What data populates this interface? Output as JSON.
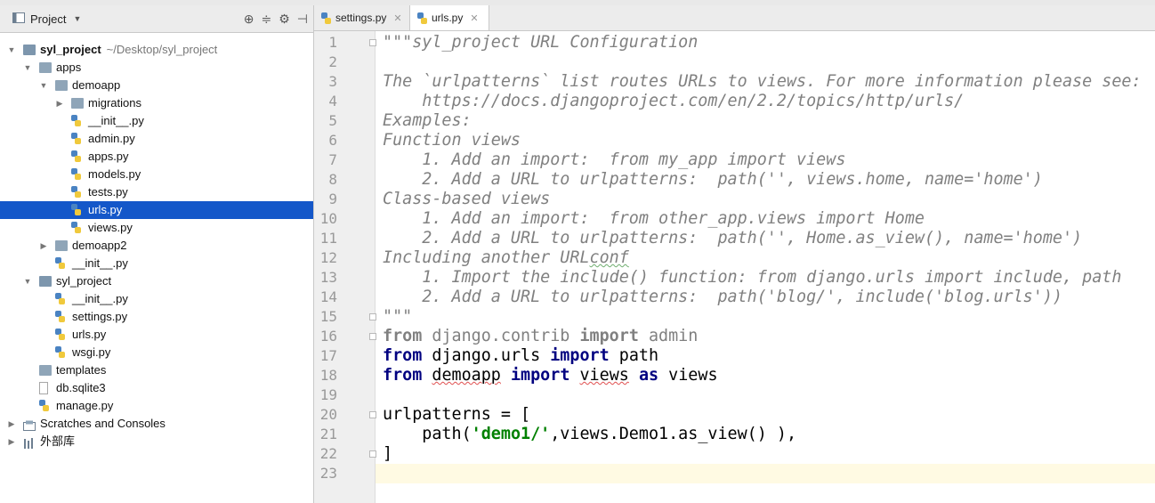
{
  "project_panel": {
    "title": "Project",
    "tree": [
      {
        "label": "syl_project",
        "sub": "~/Desktop/syl_project"
      },
      {
        "label": "apps"
      },
      {
        "label": "demoapp"
      },
      {
        "label": "migrations"
      },
      {
        "label": "__init__.py"
      },
      {
        "label": "admin.py"
      },
      {
        "label": "apps.py"
      },
      {
        "label": "models.py"
      },
      {
        "label": "tests.py"
      },
      {
        "label": "urls.py"
      },
      {
        "label": "views.py"
      },
      {
        "label": "demoapp2"
      },
      {
        "label": "__init__.py"
      },
      {
        "label": "syl_project"
      },
      {
        "label": "__init__.py"
      },
      {
        "label": "settings.py"
      },
      {
        "label": "urls.py"
      },
      {
        "label": "wsgi.py"
      },
      {
        "label": "templates"
      },
      {
        "label": "db.sqlite3"
      },
      {
        "label": "manage.py"
      },
      {
        "label": "Scratches and Consoles"
      },
      {
        "label": "外部库"
      }
    ]
  },
  "tabs": [
    {
      "label": "settings.py",
      "active": false
    },
    {
      "label": "urls.py",
      "active": true
    }
  ],
  "editor": {
    "line_numbers": [
      "1",
      "2",
      "3",
      "4",
      "5",
      "6",
      "7",
      "8",
      "9",
      "10",
      "11",
      "12",
      "13",
      "14",
      "15",
      "16",
      "17",
      "18",
      "19",
      "20",
      "21",
      "22",
      "23"
    ],
    "current_line": 23,
    "lines": [
      {
        "segs": [
          {
            "t": "\"\"\"syl_project URL Configuration",
            "c": "cm"
          }
        ]
      },
      {
        "segs": []
      },
      {
        "segs": [
          {
            "t": "The `urlpatterns` list routes URLs to views. For more information please see:",
            "c": "cm"
          }
        ]
      },
      {
        "segs": [
          {
            "t": "    https://docs.djangoproject.com/en/2.2/topics/http/urls/",
            "c": "cm"
          }
        ]
      },
      {
        "segs": [
          {
            "t": "Examples:",
            "c": "cm"
          }
        ]
      },
      {
        "segs": [
          {
            "t": "Function views",
            "c": "cm"
          }
        ]
      },
      {
        "segs": [
          {
            "t": "    1. Add an import:  from my_app import views",
            "c": "cm"
          }
        ]
      },
      {
        "segs": [
          {
            "t": "    2. Add a URL to urlpatterns:  path('', views.home, name='home')",
            "c": "cm"
          }
        ]
      },
      {
        "segs": [
          {
            "t": "Class-based views",
            "c": "cm"
          }
        ]
      },
      {
        "segs": [
          {
            "t": "    1. Add an import:  from other_app.views import Home",
            "c": "cm"
          }
        ]
      },
      {
        "segs": [
          {
            "t": "    2. Add a URL to urlpatterns:  path('', Home.as_view(), name='home')",
            "c": "cm"
          }
        ]
      },
      {
        "segs": [
          {
            "t": "Including another URL",
            "c": "cm"
          },
          {
            "t": "conf",
            "c": "cm sqg"
          }
        ]
      },
      {
        "segs": [
          {
            "t": "    1. Import the include() function: from django.urls import include, path",
            "c": "cm"
          }
        ]
      },
      {
        "segs": [
          {
            "t": "    2. Add a URL to urlpatterns:  path('blog/', include('blog.urls'))",
            "c": "cm"
          }
        ]
      },
      {
        "segs": [
          {
            "t": "\"\"\"",
            "c": "cm"
          }
        ]
      },
      {
        "segs": [
          {
            "t": "from",
            "c": "kwg"
          },
          {
            "t": " django.contrib ",
            "c": "gr"
          },
          {
            "t": "import",
            "c": "kwg"
          },
          {
            "t": " admin",
            "c": "gr"
          }
        ]
      },
      {
        "segs": [
          {
            "t": "from",
            "c": "kw"
          },
          {
            "t": " django.urls ",
            "c": ""
          },
          {
            "t": "import",
            "c": "kw"
          },
          {
            "t": " path",
            "c": ""
          }
        ]
      },
      {
        "segs": [
          {
            "t": "from",
            "c": "kw"
          },
          {
            "t": " ",
            "c": ""
          },
          {
            "t": "demoapp",
            "c": "sq"
          },
          {
            "t": " ",
            "c": ""
          },
          {
            "t": "import",
            "c": "kw"
          },
          {
            "t": " ",
            "c": ""
          },
          {
            "t": "views",
            "c": "sq"
          },
          {
            "t": " ",
            "c": ""
          },
          {
            "t": "as",
            "c": "kw"
          },
          {
            "t": " views",
            "c": ""
          }
        ]
      },
      {
        "segs": []
      },
      {
        "segs": [
          {
            "t": "urlpatterns = [",
            "c": ""
          }
        ]
      },
      {
        "segs": [
          {
            "t": "    path(",
            "c": ""
          },
          {
            "t": "'demo1/'",
            "c": "st"
          },
          {
            "t": ",views.Demo1.as_view() ),",
            "c": ""
          }
        ]
      },
      {
        "segs": [
          {
            "t": "]",
            "c": ""
          }
        ]
      },
      {
        "segs": []
      }
    ]
  },
  "icons": {
    "target": "crosshair-icon",
    "collapse": "collapse-all-icon",
    "settings": "gear-icon",
    "hide": "hide-panel-icon"
  },
  "colors": {
    "selection": "#1457c9",
    "comment": "#808080",
    "keyword": "#000080",
    "string": "#008000",
    "current_line": "#fffae3"
  }
}
